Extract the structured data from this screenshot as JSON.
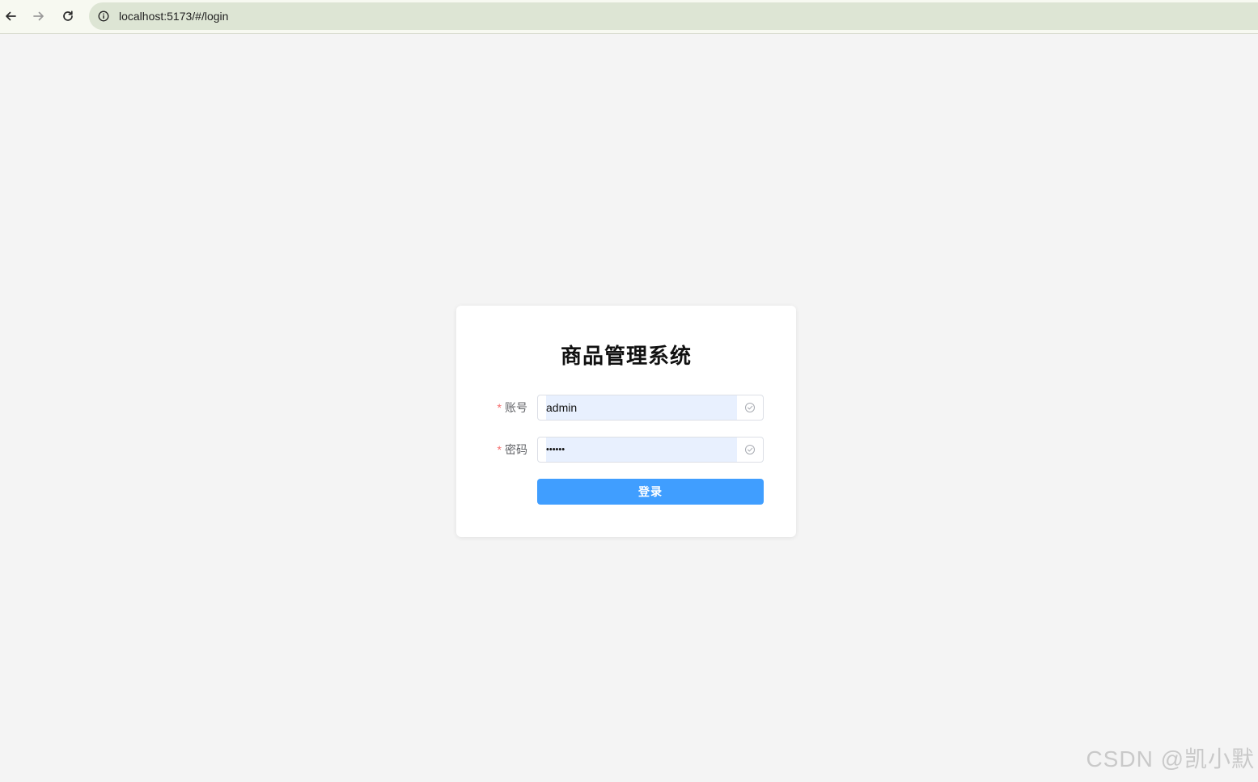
{
  "browser": {
    "url": "localhost:5173/#/login"
  },
  "login": {
    "title": "商品管理系统",
    "account": {
      "required_mark": "*",
      "label": "账号",
      "value": "admin"
    },
    "password": {
      "required_mark": "*",
      "label": "密码",
      "value": "••••••"
    },
    "submit_label": "登录"
  },
  "watermark": "CSDN @凯小默",
  "colors": {
    "primary": "#409eff",
    "autofill": "#e8f0fe",
    "required": "#f56c6c",
    "page_background": "#f4f4f4"
  },
  "icons": {
    "back": "arrow-left-icon",
    "forward": "arrow-right-icon",
    "reload": "reload-icon",
    "site_info": "info-icon",
    "input_status": "circle-check-icon"
  }
}
